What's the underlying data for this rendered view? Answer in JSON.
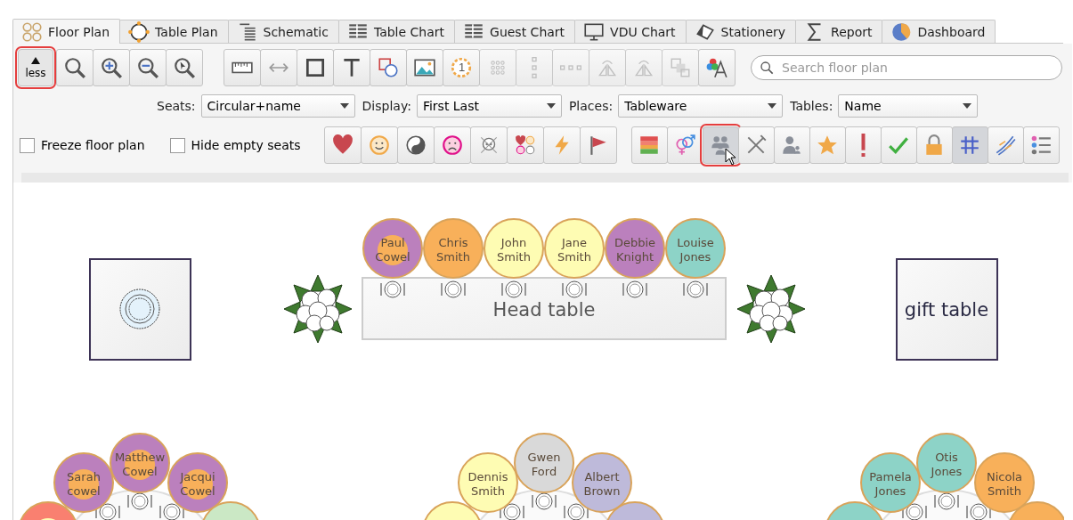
{
  "tabs": [
    {
      "label": "Floor Plan",
      "selected": true
    },
    {
      "label": "Table Plan",
      "selected": false
    },
    {
      "label": "Schematic",
      "selected": false
    },
    {
      "label": "Table Chart",
      "selected": false
    },
    {
      "label": "Guest Chart",
      "selected": false
    },
    {
      "label": "VDU Chart",
      "selected": false
    },
    {
      "label": "Stationery",
      "selected": false
    },
    {
      "label": "Report",
      "selected": false
    },
    {
      "label": "Dashboard",
      "selected": false
    }
  ],
  "less_button": {
    "label": "less",
    "highlighted": true
  },
  "tool_buttons": [
    {
      "disabled": false
    },
    {
      "disabled": false
    },
    {
      "disabled": false
    },
    {
      "disabled": false
    },
    {
      "disabled": false
    },
    {
      "disabled": false
    },
    {
      "disabled": false,
      "number": "1"
    },
    {
      "disabled": true
    },
    {
      "disabled": true
    },
    {
      "disabled": true
    },
    {
      "disabled": true
    },
    {
      "disabled": true
    },
    {
      "disabled": true
    },
    {
      "disabled": false
    }
  ],
  "search": {
    "placeholder": "Search floor plan"
  },
  "dropdowns": [
    {
      "label": "Seats:",
      "value": "Circular+name"
    },
    {
      "label": "Display:",
      "value": "First Last"
    },
    {
      "label": "Places:",
      "value": "Tableware"
    },
    {
      "label": "Tables:",
      "value": "Name"
    }
  ],
  "checkboxes": [
    {
      "label": "Freeze floor plan",
      "checked": false
    },
    {
      "label": "Hide empty seats",
      "checked": false
    }
  ],
  "display_toggles": [
    {
      "pressed": false,
      "highlighted": false
    },
    {
      "pressed": false,
      "highlighted": false
    },
    {
      "pressed": true,
      "highlighted": true
    },
    {
      "pressed": false,
      "highlighted": false
    },
    {
      "pressed": false,
      "highlighted": false
    },
    {
      "pressed": false,
      "highlighted": false
    },
    {
      "pressed": false,
      "highlighted": false
    },
    {
      "pressed": false,
      "highlighted": false
    },
    {
      "pressed": false,
      "highlighted": false
    },
    {
      "pressed": true,
      "highlighted": false
    },
    {
      "pressed": false,
      "highlighted": false
    },
    {
      "pressed": false,
      "highlighted": false
    }
  ],
  "floor_plan": {
    "tables": [
      {
        "kind": "square"
      },
      {
        "kind": "head",
        "label": "Head table",
        "seats": [
          {
            "name": "Paul Cowel",
            "color": "#bb80bd",
            "marker": {
              "color": "#f8b05a"
            }
          },
          {
            "name": "Chris Smith",
            "color": "#f8b05a"
          },
          {
            "name": "John Smith",
            "color": "#fefcb3"
          },
          {
            "name": "Jane Smith",
            "color": "#fefcb3"
          },
          {
            "name": "Debbie Knight",
            "color": "#bb80bd"
          },
          {
            "name": "Louise Jones",
            "color": "#8dd3c7"
          }
        ]
      },
      {
        "kind": "square",
        "label": "gift table"
      },
      {
        "kind": "round",
        "seats": [
          {
            "color": "#f98070",
            "marker": {
              "color": "#fefcb3"
            }
          },
          {
            "name": "Sarah cowel",
            "color": "#bb80bd",
            "marker": {
              "color": "#f8b05a"
            }
          },
          {
            "name": "Matthew Cowel",
            "color": "#bb80bd",
            "marker": {
              "color": "#f8b05a"
            }
          },
          {
            "name": "Jacqui Cowel",
            "color": "#bb80bd",
            "marker": {
              "color": "#f8b05a"
            }
          },
          {
            "color": "#cbe8c5"
          }
        ]
      },
      {
        "kind": "round",
        "seats": [
          {
            "color": "#fefcb3"
          },
          {
            "name": "Dennis Smith",
            "color": "#fefcb3"
          },
          {
            "name": "Gwen Ford",
            "color": "#d9d9d9"
          },
          {
            "name": "Albert Brown",
            "color": "#bebada"
          },
          {
            "color": "#bebada"
          }
        ]
      },
      {
        "kind": "round",
        "seats": [
          {
            "color": "#8dd3c7"
          },
          {
            "name": "Pamela Jones",
            "color": "#8dd3c7"
          },
          {
            "name": "Otis Jones",
            "color": "#8dd3c7"
          },
          {
            "name": "Nicola Smith",
            "color": "#f8b05a"
          },
          {
            "color": "#f8b05a"
          }
        ]
      }
    ]
  }
}
